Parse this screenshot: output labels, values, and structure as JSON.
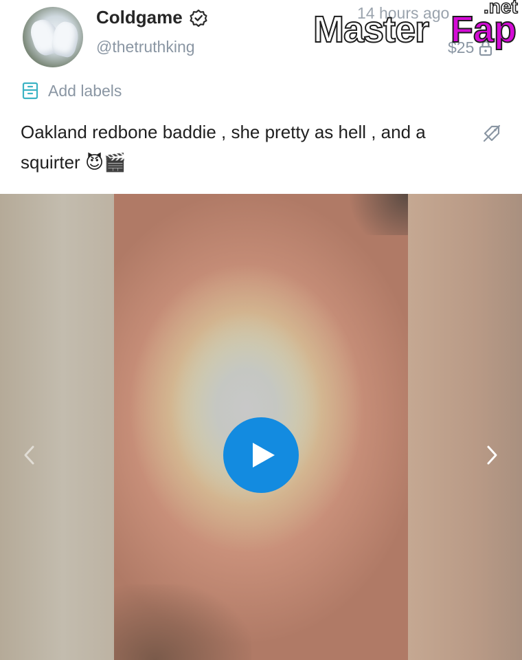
{
  "post": {
    "display_name": "Coldgame",
    "handle": "@thetruthking",
    "timestamp": "14 hours ago",
    "price": "$25",
    "add_labels": "Add labels",
    "caption": "Oakland redbone baddie , she pretty as hell , and a squirter",
    "caption_emoji": "😈🎬"
  },
  "watermark": {
    "brand_main": "Master",
    "brand_accent": "Fap",
    "brand_tld": ".net"
  },
  "icons": {
    "verified": "verified-badge-icon",
    "lock": "lock-icon",
    "labels": "labels-icon",
    "edit_tag": "tag-slash-icon",
    "play": "play-icon",
    "prev": "chevron-left-icon",
    "next": "chevron-right-icon"
  },
  "colors": {
    "accent": "#138be0",
    "labels_accent": "#3bb3c4",
    "muted_text": "#8a96a3",
    "watermark_accent": "#d40bd6"
  }
}
